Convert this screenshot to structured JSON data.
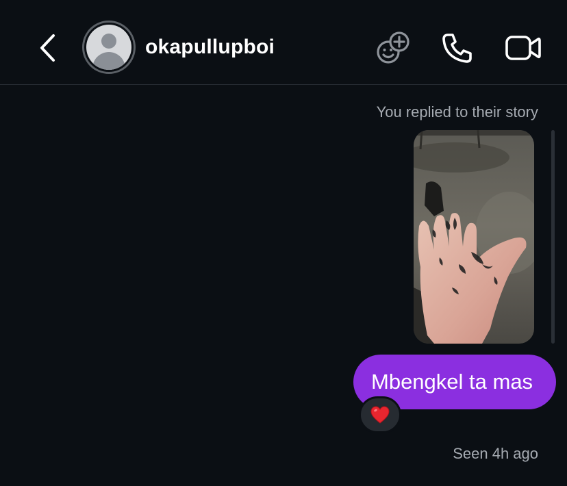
{
  "header": {
    "username": "okapullupboi",
    "icons": {
      "back": "chevron-left-icon",
      "effects": "face-plus-icon",
      "call": "phone-icon",
      "video": "video-camera-icon"
    }
  },
  "thread": {
    "story_label": "You replied to their story",
    "messages": [
      {
        "text": "Mbengkel ta mas",
        "reaction": "❤️"
      }
    ],
    "seen_text": "Seen 4h ago"
  },
  "colors": {
    "background": "#0b0f14",
    "bubble": "#8b2fe0",
    "muted_text": "#a6abb2"
  }
}
